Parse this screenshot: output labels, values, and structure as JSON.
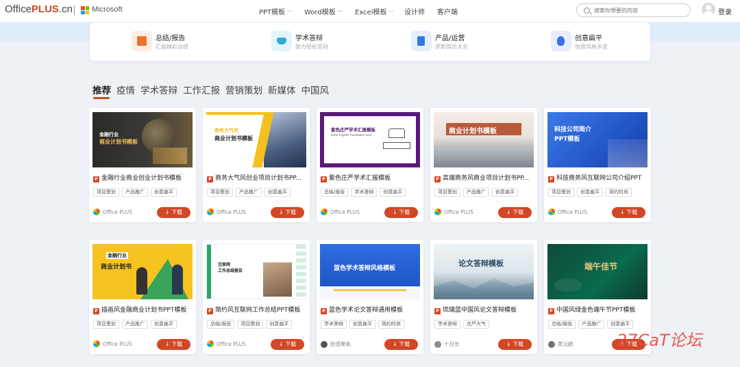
{
  "header": {
    "logo_office": "Office",
    "logo_plus": "PLUS",
    "logo_cn": ".cn",
    "microsoft": "Microsoft",
    "nav": [
      "PPT模板",
      "Word模板",
      "Excel模板",
      "设计师",
      "客户端"
    ],
    "search_placeholder": "搜索你想要的内容",
    "login": "登录"
  },
  "categories": [
    {
      "title": "总结/报告",
      "desc": "汇报精彩总结",
      "icon": "calendar-check-icon",
      "color": "#f0712c"
    },
    {
      "title": "学术答辩",
      "desc": "助力轻松答辩",
      "icon": "graduation-cap-icon",
      "color": "#2fa9d8"
    },
    {
      "title": "产品/运营",
      "desc": "求职简历大全",
      "icon": "document-icon",
      "color": "#3478e5"
    },
    {
      "title": "创意扁平",
      "desc": "创意风格多变",
      "icon": "lightbulb-icon",
      "color": "#3a6ee8"
    }
  ],
  "tabs": [
    "推荐",
    "疫情",
    "学术答辩",
    "工作汇报",
    "营销策划",
    "新媒体",
    "中国风"
  ],
  "colors": {
    "accent": "#d24726",
    "ppt_badge": "#d24726"
  },
  "download_label": "↓ 下载",
  "ppt_badge": "P",
  "cards": [
    {
      "title": "金融行业商业创业计划书模板",
      "tags": [
        "项目策划",
        "产品推广",
        "创意扁平"
      ],
      "author": "Office PLUS",
      "thumb_title": "金融行业",
      "thumb_title2": "商业计划书模板"
    },
    {
      "title": "商务大气风创业项目计划书PP...",
      "tags": [
        "项目策划",
        "产品推广",
        "创意扁平"
      ],
      "author": "Office PLUS",
      "thumb_title": "商务大气风",
      "thumb_title2": "商业计划书模板"
    },
    {
      "title": "紫色庄严学术汇报模板",
      "tags": [
        "总结/报告",
        "学术答辩",
        "创意扁平"
      ],
      "author": "Office PLUS",
      "thumb_title": "紫色庄严学术汇报模板",
      "thumb_title2": "Enter English translation here"
    },
    {
      "title": "高端商务风商业项目计划书PP...",
      "tags": [
        "项目策划",
        "产品推广",
        "创意扁平"
      ],
      "author": "Office PLUS",
      "thumb_title": "商业计划书模板",
      "thumb_title2": ""
    },
    {
      "title": "科技商务风互联网公司介绍PPT",
      "tags": [
        "项目策划",
        "创意扁平",
        "简约时尚"
      ],
      "author": "Office PLUS",
      "thumb_title": "科技公司简介",
      "thumb_title2": "PPT模板"
    },
    {
      "title": "插画风金融商业计划书PPT模板",
      "tags": [
        "项目策划",
        "产品推广",
        "创意扁平"
      ],
      "author": "Office PLUS",
      "thumb_title": "金融行业",
      "thumb_title2": "商业计划书"
    },
    {
      "title": "简约风互联网工作总结PPT模板",
      "tags": [
        "总结/报告",
        "项目策划",
        "创意扁平"
      ],
      "author": "Office PLUS",
      "thumb_title": "互联网",
      "thumb_title2": "工作总结报告"
    },
    {
      "title": "蓝色学术论文答辩通用模板",
      "tags": [
        "学术答辩",
        "创意扁平",
        "简约时尚"
      ],
      "author": "拾感聚氧",
      "thumb_title": "蓝色学术答辩风格模板",
      "thumb_title2": ""
    },
    {
      "title": "琉璃蓝中国风论文答辩模板",
      "tags": [
        "学术答辩",
        "庄严大气"
      ],
      "author": "十月长",
      "thumb_title": "论文答辩模板",
      "thumb_title2": ""
    },
    {
      "title": "中国风绿金色端午节PPT模板",
      "tags": [
        "总结/报告",
        "产品推广",
        "创意扁平"
      ],
      "author": "黄沅鹂",
      "thumb_title": "端午佳节",
      "thumb_title2": ""
    }
  ],
  "watermark": "27CaT论坛"
}
